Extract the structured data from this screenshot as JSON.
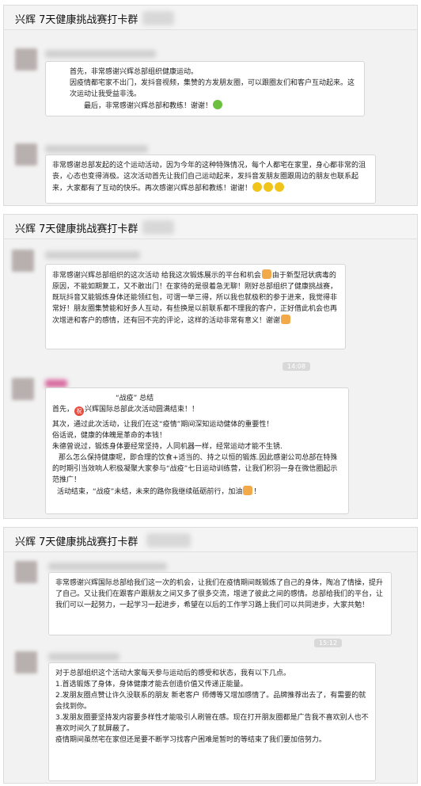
{
  "panel1": {
    "title": "兴辉 7天健康挑战赛打卡群",
    "msg1": [
      "首先，非常感谢兴辉总部组织健康运动。",
      "因疫情都宅家不出门，发抖音视频，集赞的方发朋友圈，可以跟圈友们和客户互动起来。这次运动让我受益非浅。",
      "最后，非常感谢兴辉总部和教练！谢谢！"
    ],
    "msg2": "非常感谢总部发起的这个运动活动，因为今年的这种特殊情况，每个人都宅在家里，身心都非常的沮丧，心态也变得消极。这次活动首先让我们自己运动起来，发抖音发朋友圈跟周边的朋友也联系起来，大家都有了互动的快乐。再次感谢兴辉总部和教练！谢谢！"
  },
  "panel2": {
    "title": "兴辉 7天健康挑战赛打卡群",
    "msg1a": "非常感谢兴辉总部组织的这次活动 给我这次锻炼展示的平台和机会",
    "msg1b": "由于新型冠状病毒的原因，不能如期复工，又不敢出门！在家待的是很着急无聊！刚好总部组织了健康挑战赛，既玩抖音又能锻炼身体还能领红包，可谓一举三得，所以我也就极积的参于进来，我觉得非常好！朋友圈集赞能和好多人互动，有些换是以前联系都不理我的客户，正好借此机会也再次增进和客户的感情，还有回不完的评论，这样的活动非常有意义！谢谢",
    "time": "14:08",
    "msg2_title": "“战疫” 总结",
    "msg2_line1": "首先，",
    "msg2_badge": "祝",
    "msg2_line1b": "兴辉国际总部此次活动圆满结束！！",
    "msg2_line2": "其次，通过此次活动，让我们在这“疫情”期间深知运动健体的重要性！",
    "msg2_line3": "俗话说，健康的体魄是革命的本钱！",
    "msg2_line4": "朱德曾说过，锻炼身体要经常坚持，人同机器一样，经常运动才能不生锈.",
    "msg2_line5": "那么怎么保持健康呢，即合理的饮食+适当的、持之以恒的锻炼.因此感谢公司总部在特殊的时期引当效响人积极凝聚大家参与“战疫”七日运动训练营，让我们积羽一身在微信圈起示范推广！",
    "msg2_line6": "活动结束，“战疫”未结，未来的路你我继续砥砺前行，加油",
    "msg2_end": "！"
  },
  "panel3": {
    "title": "兴辉 7天健康挑战赛打卡群",
    "msg1": "非常感谢兴辉国际总部给我们这一次的机会，让我们在疫情期间既锻炼了自己的身体，陶冶了情操，提升了自己。又让我们在跟客户跟朋友之间又多了很多交流，增进了彼此之间的感情。总部给我们的平台，让我们可以一起努力，一起学习一起进步，希望在以后的工作学习路上我们可以共同进步，大家共勉！",
    "time": "15:12",
    "msg2": [
      "对于总部组织这个活动大家每天参与运动后的感受和状态，我有以下几点。",
      "1.首选锻炼了身体，身体健康才能去创造价值又传递正能量。",
      "2.发朋友圈点赞让许久没联系的朋友 新老客户 师傅等又增加感情了。品牌推荐出去了，有需要的就会找到你。",
      "3.发朋友圈要坚持发内容要多样性才能吸引人刷管在感。现在打开朋友圈都是广告我不喜欢别人也不喜欢时间久了就屏蔽了。",
      "疫情期间虽然宅在家但还是要不断学习找客户困难是暂时的等结束了我们要加倍努力。"
    ]
  },
  "colors": {
    "panel_bg": "#f2f2f2",
    "bubble_bg": "#ffffff",
    "time_bg": "#d9d9d9"
  }
}
